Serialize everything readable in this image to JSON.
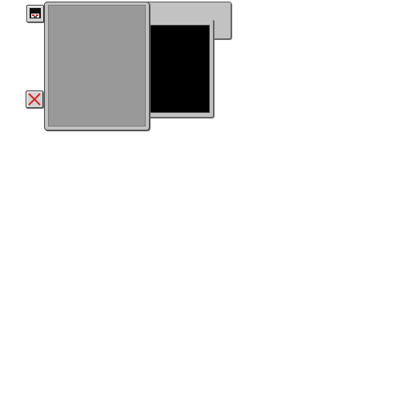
{
  "colors": {
    "panel": "#c2c2c2",
    "grey_view": "#999999",
    "black_view": "#000000",
    "close_red": "#e02020"
  },
  "icons": {
    "inventory": "character-inventory-icon",
    "close": "close-x-icon"
  }
}
